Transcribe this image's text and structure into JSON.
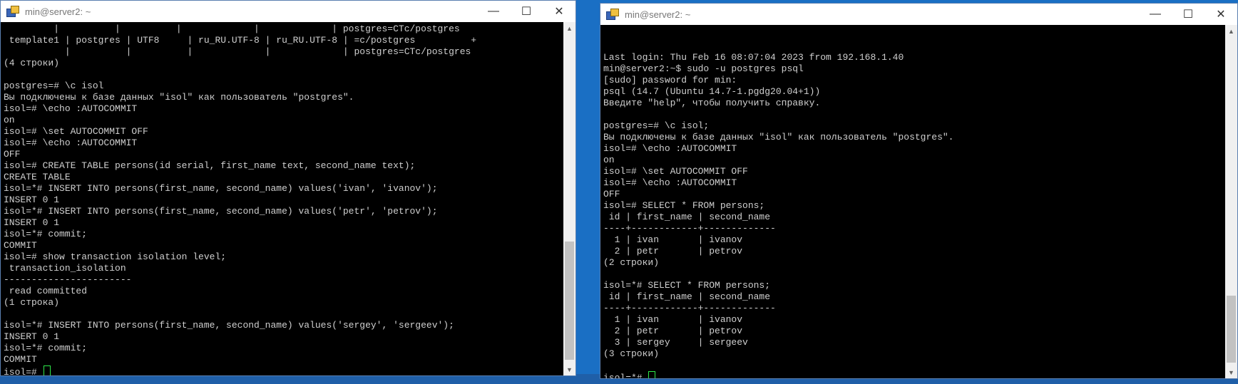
{
  "left_window": {
    "title": "min@server2: ~",
    "lines": [
      "         |          |          |             |             | postgres=CTc/postgres",
      " template1 | postgres | UTF8     | ru_RU.UTF-8 | ru_RU.UTF-8 | =c/postgres          +",
      "           |          |          |             |             | postgres=CTc/postgres",
      "(4 строки)",
      "",
      "postgres=# \\c isol",
      "Вы подключены к базе данных \"isol\" как пользователь \"postgres\".",
      "isol=# \\echo :AUTOCOMMIT",
      "on",
      "isol=# \\set AUTOCOMMIT OFF",
      "isol=# \\echo :AUTOCOMMIT",
      "OFF",
      "isol=# CREATE TABLE persons(id serial, first_name text, second_name text);",
      "CREATE TABLE",
      "isol=*# INSERT INTO persons(first_name, second_name) values('ivan', 'ivanov');",
      "INSERT 0 1",
      "isol=*# INSERT INTO persons(first_name, second_name) values('petr', 'petrov');",
      "INSERT 0 1",
      "isol=*# commit;",
      "COMMIT",
      "isol=# show transaction isolation level;",
      " transaction_isolation",
      "-----------------------",
      " read committed",
      "(1 строка)",
      "",
      "isol=*# INSERT INTO persons(first_name, second_name) values('sergey', 'sergeev');",
      "INSERT 0 1",
      "isol=*# commit;",
      "COMMIT"
    ],
    "prompt": "isol=# "
  },
  "right_window": {
    "title": "min@server2: ~",
    "lines": [
      "",
      "",
      "Last login: Thu Feb 16 08:07:04 2023 from 192.168.1.40",
      "min@server2:~$ sudo -u postgres psql",
      "[sudo] password for min:",
      "psql (14.7 (Ubuntu 14.7-1.pgdg20.04+1))",
      "Введите \"help\", чтобы получить справку.",
      "",
      "postgres=# \\c isol;",
      "Вы подключены к базе данных \"isol\" как пользователь \"postgres\".",
      "isol=# \\echo :AUTOCOMMIT",
      "on",
      "isol=# \\set AUTOCOMMIT OFF",
      "isol=# \\echo :AUTOCOMMIT",
      "OFF",
      "isol=# SELECT * FROM persons;",
      " id | first_name | second_name",
      "----+------------+-------------",
      "  1 | ivan       | ivanov",
      "  2 | petr       | petrov",
      "(2 строки)",
      "",
      "isol=*# SELECT * FROM persons;",
      " id | first_name | second_name",
      "----+------------+-------------",
      "  1 | ivan       | ivanov",
      "  2 | petr       | petrov",
      "  3 | sergey     | sergeev",
      "(3 строки)",
      ""
    ],
    "prompt": "isol=*# "
  },
  "controls": {
    "minimize": "—",
    "maximize": "☐",
    "close": "✕",
    "scroll_up": "▲",
    "scroll_down": "▼"
  },
  "icons": {
    "app": "putty-icon",
    "minimize": "minimize-icon",
    "maximize": "maximize-icon",
    "close": "close-icon"
  }
}
